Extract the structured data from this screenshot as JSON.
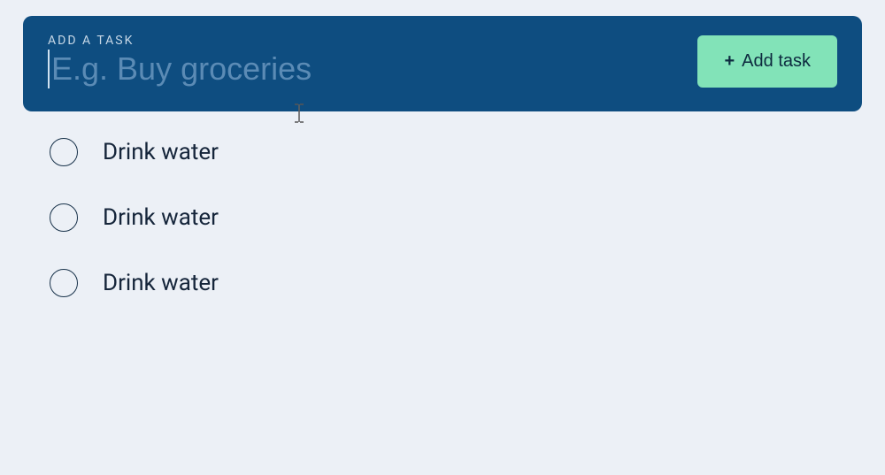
{
  "addPanel": {
    "label": "Add a task",
    "placeholder": "E.g. Buy groceries",
    "value": "",
    "buttonLabel": "Add task"
  },
  "tasks": [
    {
      "text": "Drink water",
      "done": false
    },
    {
      "text": "Drink water",
      "done": false
    },
    {
      "text": "Drink water",
      "done": false
    }
  ],
  "colors": {
    "panel": "#0e4d80",
    "button": "#82e3b8",
    "background": "#ecf0f6",
    "text": "#15253a"
  }
}
